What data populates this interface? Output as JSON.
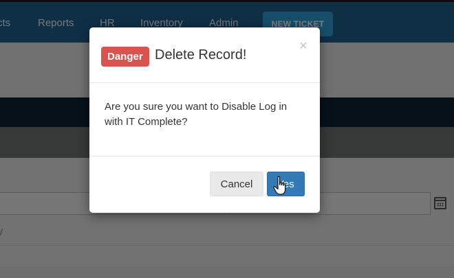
{
  "nav": {
    "items": [
      {
        "label": "cts"
      },
      {
        "label": "Reports"
      },
      {
        "label": "HR"
      },
      {
        "label": "Inventory"
      },
      {
        "label": "Admin"
      }
    ],
    "new_ticket": "NEW TICKET"
  },
  "background": {
    "partial_text": "/"
  },
  "modal": {
    "badge": "Danger",
    "title": "Delete Record!",
    "message": "Are you sure you want to Disable Log in with IT Complete?",
    "close_glyph": "×",
    "cancel_label": "Cancel",
    "yes_label": "Yes"
  },
  "colors": {
    "nav_bg": "#1f5f8b",
    "ticket_btn": "#2f9ed4",
    "danger": "#d9534f",
    "primary": "#337ab7"
  },
  "icons": [
    "calendar-icon",
    "close-icon",
    "hand-pointer-cursor-icon"
  ]
}
